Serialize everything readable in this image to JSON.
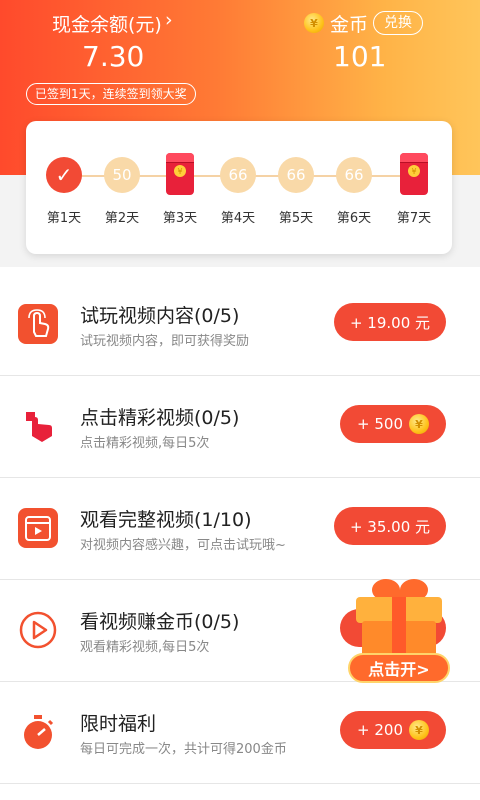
{
  "header": {
    "cash_label": "现金余额(元)",
    "cash_arrow": "›",
    "cash_value": "7.30",
    "streak_text": "已签到1天，连续签到领大奖",
    "coin_label": "金币",
    "exchange_label": "兑换",
    "coin_value": "101",
    "coin_glyph": "¥"
  },
  "checkin": {
    "days": [
      {
        "label": "第1天",
        "value": "✓",
        "kind": "checked"
      },
      {
        "label": "第2天",
        "value": "50",
        "kind": "coin"
      },
      {
        "label": "第3天",
        "value": "",
        "kind": "red-packet"
      },
      {
        "label": "第4天",
        "value": "66",
        "kind": "coin"
      },
      {
        "label": "第5天",
        "value": "66",
        "kind": "coin"
      },
      {
        "label": "第6天",
        "value": "66",
        "kind": "coin"
      },
      {
        "label": "第7天",
        "value": "",
        "kind": "red-packet"
      }
    ]
  },
  "tasks": [
    {
      "title": "试玩视频内容(0/5)",
      "desc": "试玩视频内容，即可获得奖励",
      "reward": "+ 19.00 元",
      "icon": "tap-hand-icon"
    },
    {
      "title": "点击精彩视频(0/5)",
      "desc": "点击精彩视频,每日5次",
      "reward": "+ 500",
      "icon": "click-pointer-icon"
    },
    {
      "title": "观看完整视频(1/10)",
      "desc": "对视频内容感兴趣，可点击试玩哦~",
      "reward": "+ 35.00 元",
      "icon": "video-clapper-icon"
    },
    {
      "title": "看视频赚金币(0/5)",
      "desc": "观看精彩视频,每日5次",
      "reward": "",
      "icon": "play-circle-icon"
    },
    {
      "title": "限时福利",
      "desc": "每日可完成一次，共计可得200金币",
      "reward": "+ 200",
      "icon": "stopwatch-icon"
    }
  ],
  "gift": {
    "label": "点击开>"
  },
  "colors": {
    "accent": "#f24a35",
    "gradient_start": "#ff4a2c",
    "gradient_end": "#ffc55a"
  }
}
